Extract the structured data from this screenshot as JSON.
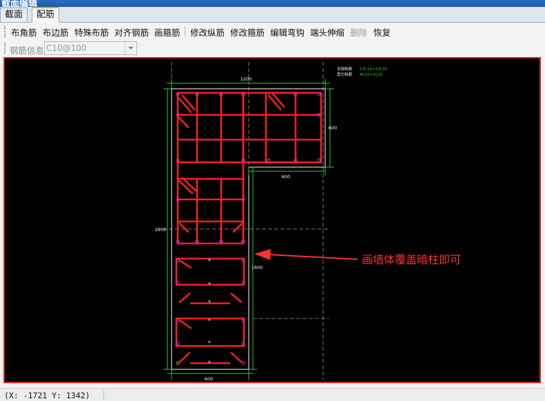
{
  "window": {
    "title": "截面编辑"
  },
  "tabs": [
    {
      "label": "截面",
      "active": false
    },
    {
      "label": "配筋",
      "active": true
    }
  ],
  "toolbar": {
    "items": [
      {
        "label": "布角筋",
        "enabled": true
      },
      {
        "label": "布边筋",
        "enabled": true
      },
      {
        "label": "特殊布筋",
        "enabled": true
      },
      {
        "label": "对齐钢筋",
        "enabled": true
      },
      {
        "label": "画箍筋",
        "enabled": true
      },
      {
        "label": "修改纵筋",
        "enabled": true
      },
      {
        "label": "修改箍筋",
        "enabled": true
      },
      {
        "label": "编辑弯钩",
        "enabled": true
      },
      {
        "label": "端头伸缩",
        "enabled": true
      },
      {
        "label": "删除",
        "enabled": false
      },
      {
        "label": "恢复",
        "enabled": true
      }
    ]
  },
  "rebar_info": {
    "label": "钢筋信息",
    "value": "C10@100"
  },
  "drawing": {
    "dim_top": "1200",
    "dim_right": "600",
    "dim_notch": "600",
    "dim_left": "2200",
    "dim_inner": "1600",
    "dim_bottom": "600",
    "legend_1_key": "全部纵筋",
    "legend_1_val": "13C14+24C25",
    "legend_2_key": "其它纵筋",
    "legend_2_val": "4C14+2C25",
    "annotation": "画墙体覆盖暗柱即可",
    "colors": {
      "rebar": "#ff2020",
      "dimension": "#27d027",
      "outline": "#ffffff",
      "annotation": "#ff3030",
      "bar_dot": "#e020e0"
    }
  },
  "statusbar": {
    "coords": "(X: -1721 Y: 1342)"
  }
}
